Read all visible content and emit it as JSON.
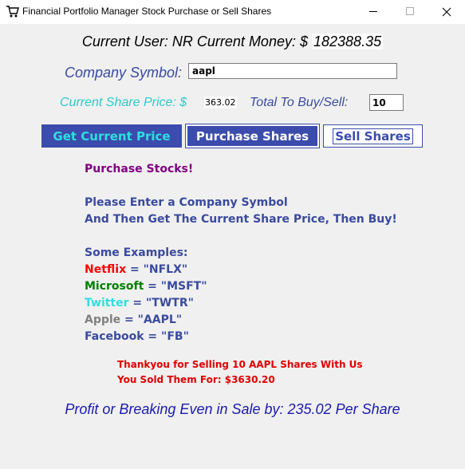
{
  "window": {
    "title": "Financial Portfolio Manager Stock Purchase or Sell Shares",
    "icon": "shopping-cart-icon"
  },
  "header": {
    "user_label": "Current User: NR Current Money: $",
    "money_value": "182388.35"
  },
  "form": {
    "symbol_label": "Company Symbol:",
    "symbol_value": "aapl",
    "price_label": "Current Share Price: $",
    "price_value": "363.02",
    "total_label": "Total To Buy/Sell:",
    "total_value": "10"
  },
  "buttons": {
    "get_price": "Get Current Price",
    "purchase": "Purchase Shares",
    "sell": "Sell Shares"
  },
  "info": {
    "heading": "Purchase Stocks!",
    "instr_1": "Please Enter a Company Symbol",
    "instr_2": "And Then Get The Current Share Price, Then Buy!",
    "examples_heading": "Some Examples:",
    "examples": [
      {
        "name": "Netflix",
        "rest": " = \"NFLX\"",
        "color": "#ff0000"
      },
      {
        "name": "Microsoft",
        "rest": " = \"MSFT\"",
        "color": "#008000"
      },
      {
        "name": "Twitter",
        "rest": " = \"TWTR\"",
        "color": "#2fdfe0"
      },
      {
        "name": "Apple",
        "rest": " = \"AAPL\"",
        "color": "#808080"
      },
      {
        "name": "Facebook",
        "rest": " = \"FB\"",
        "color": "#3a4a9e"
      }
    ]
  },
  "status": {
    "line_1": "Thankyou for Selling 10 AAPL Shares With Us",
    "line_2": "You Sold Them For: $3630.20"
  },
  "profit": "Profit or Breaking Even in Sale by: 235.02 Per Share",
  "colors": {
    "accent": "#3b4cad",
    "cyan": "#2fdfe0",
    "purple": "#800080",
    "red": "#ff0000"
  }
}
